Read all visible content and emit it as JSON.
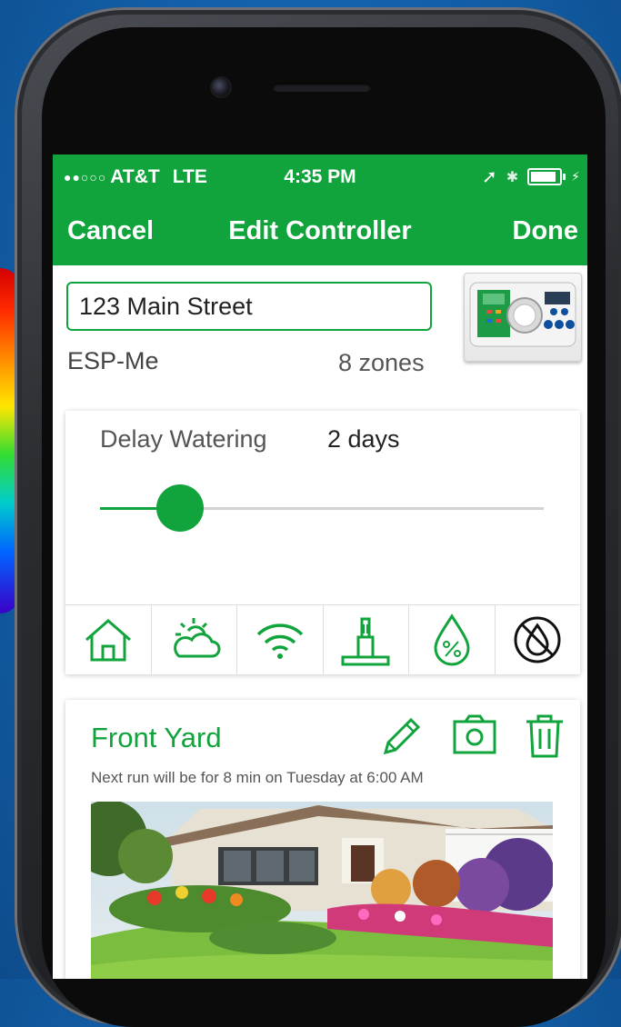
{
  "status_bar": {
    "signal_dots": "●●○○○",
    "carrier": "AT&T",
    "network": "LTE",
    "time": "4:35 PM",
    "location_glyph": "➚",
    "bluetooth_glyph": "✱",
    "charging_glyph": "⚡"
  },
  "nav": {
    "cancel_label": "Cancel",
    "title": "Edit Controller",
    "done_label": "Done"
  },
  "controller": {
    "name": "123 Main Street",
    "model": "ESP-Me",
    "zones": "8 zones"
  },
  "delay": {
    "label": "Delay Watering",
    "value": "2 days",
    "slider_fraction": 0.18
  },
  "tool_icons": [
    "home-icon",
    "weather-icon",
    "wifi-icon",
    "sensor-icon",
    "seasonal-adjust-icon",
    "rain-off-icon"
  ],
  "zone": {
    "name": "Front Yard",
    "next_run": "Next run will be for 8 min on Tuesday at 6:00 AM",
    "actions": [
      "edit-pencil-icon",
      "camera-icon",
      "trash-icon"
    ]
  },
  "colors": {
    "accent": "#11a43c",
    "background": "#135fa8"
  }
}
